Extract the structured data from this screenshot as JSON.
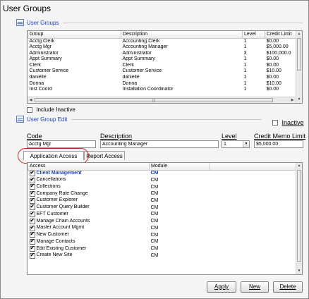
{
  "window": {
    "title": "User Groups"
  },
  "user_groups": {
    "section_label": "User Groups",
    "columns": [
      "Group",
      "Description",
      "Level",
      "Credit Limit"
    ],
    "rows": [
      [
        "Acctg Clerk",
        "Accounting Clerk",
        "1",
        "$0.00"
      ],
      [
        "Acctg Mgr",
        "Accounting Manager",
        "1",
        "$5,000.00"
      ],
      [
        "Administrator",
        "Administrator",
        "3",
        "$100,000.0"
      ],
      [
        "Appt Summary",
        "Appt Summary",
        "1",
        "$0.00"
      ],
      [
        "Clerk",
        "Clerk",
        "1",
        "$0.00"
      ],
      [
        "Customer Service",
        "Customer Service",
        "1",
        "$10.00"
      ],
      [
        "danielle",
        "danielle",
        "1",
        "$0.00"
      ],
      [
        "Donna",
        "Donna",
        "1",
        "$10.00"
      ],
      [
        "Inst Coord",
        "Installation Coordinator",
        "1",
        "$0.00"
      ]
    ],
    "hscroll_grip": "|||"
  },
  "include_inactive": {
    "label": "Include Inactive",
    "checked": false
  },
  "edit": {
    "section_label": "User Group Edit",
    "inactive_label": "Inactive",
    "inactive_checked": false,
    "code_label": "Code",
    "code_value": "Acctg Mgr",
    "description_label": "Description",
    "description_value": "Accounting Manager",
    "level_label": "Level",
    "level_value": "1",
    "credit_label": "Credit Memo Limit",
    "credit_value": "$5,000.00"
  },
  "tabs": [
    {
      "label": "Application Access",
      "active": true
    },
    {
      "label": "Report Access",
      "active": false
    }
  ],
  "access": {
    "columns": [
      "Access",
      "Module"
    ],
    "rows": [
      {
        "name": "Client Management",
        "module": "CM",
        "checked": true,
        "highlight": true
      },
      {
        "name": "Cancellations",
        "module": "CM",
        "checked": true
      },
      {
        "name": "Collections",
        "module": "CM",
        "checked": true
      },
      {
        "name": "Company Rate Change",
        "module": "CM",
        "checked": true
      },
      {
        "name": "Customer Explorer",
        "module": "CM",
        "checked": true
      },
      {
        "name": "Customer Query Builder",
        "module": "CM",
        "checked": true
      },
      {
        "name": "EFT Customer",
        "module": "CM",
        "checked": true
      },
      {
        "name": "Manage Chain Accounts",
        "module": "CM",
        "checked": true
      },
      {
        "name": "Master Account Mgmt",
        "module": "CM",
        "checked": true
      },
      {
        "name": "New Customer",
        "module": "CM",
        "checked": true
      },
      {
        "name": "Manage Contacts",
        "module": "CM",
        "checked": true
      },
      {
        "name": "Edit Existing Customer",
        "module": "CM",
        "checked": true
      },
      {
        "name": "Create New Site",
        "module": "CM",
        "checked": true
      }
    ]
  },
  "buttons": {
    "apply": "Apply",
    "new": "New",
    "delete": "Delete"
  },
  "colors": {
    "link_blue": "#1d3fbb",
    "highlight_ring": "#c0262b"
  }
}
